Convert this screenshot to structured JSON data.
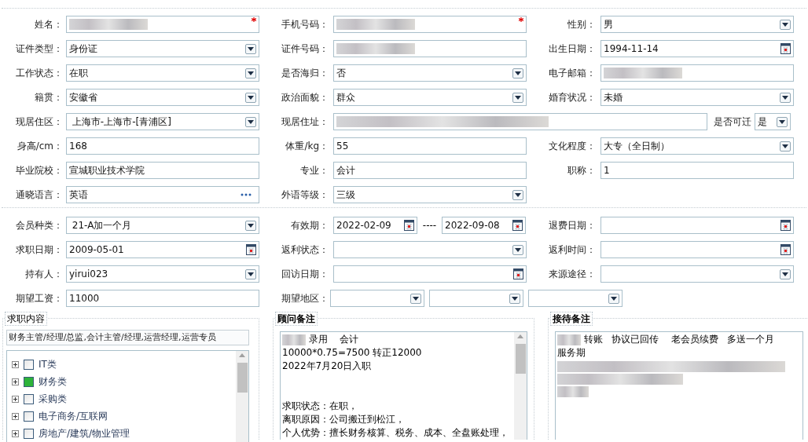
{
  "personal_rows": [
    [
      {
        "label": "姓名：",
        "kind": "redacted",
        "required": true
      },
      {
        "label": "手机号码：",
        "kind": "redacted",
        "required": true
      },
      {
        "label": "性别：",
        "kind": "select",
        "value": "男"
      }
    ],
    [
      {
        "label": "证件类型：",
        "kind": "select",
        "value": "身份证"
      },
      {
        "label": "证件号码：",
        "kind": "redacted"
      },
      {
        "label": "出生日期：",
        "kind": "date",
        "value": "1994-11-14"
      }
    ],
    [
      {
        "label": "工作状态：",
        "kind": "select",
        "value": "在职"
      },
      {
        "label": "是否海归：",
        "kind": "select",
        "value": "否"
      },
      {
        "label": "电子邮箱：",
        "kind": "redacted"
      }
    ],
    [
      {
        "label": "籍贯：",
        "kind": "select",
        "value": "安徽省"
      },
      {
        "label": "政治面貌：",
        "kind": "select",
        "value": "群众"
      },
      {
        "label": "婚育状况：",
        "kind": "select",
        "value": "未婚"
      }
    ],
    [
      {
        "label": "现居住区：",
        "kind": "select",
        "value": " 上海市-上海市-[青浦区]"
      },
      {
        "label": "现居住址：",
        "kind": "redacted",
        "wide": true
      },
      {
        "label": "是否可迁",
        "kind": "select",
        "value": "是",
        "compact": true
      }
    ],
    [
      {
        "label": "身高/cm：",
        "kind": "text",
        "value": "168"
      },
      {
        "label": "体重/kg：",
        "kind": "text",
        "value": "55"
      },
      {
        "label": "文化程度：",
        "kind": "select",
        "value": "大专（全日制）"
      }
    ],
    [
      {
        "label": "毕业院校：",
        "kind": "text",
        "value": "宣城职业技术学院"
      },
      {
        "label": "专业：",
        "kind": "text",
        "value": "会计"
      },
      {
        "label": "职称：",
        "kind": "text",
        "value": "1"
      }
    ],
    [
      {
        "label": "通晓语言：",
        "kind": "lookup",
        "value": "英语"
      },
      {
        "label": "外语等级：",
        "kind": "select",
        "value": "三级"
      }
    ]
  ],
  "membership_rows": [
    [
      {
        "label": "会员种类：",
        "kind": "select",
        "value": " 21-A加一个月"
      },
      {
        "label": "有效期：",
        "kind": "date_range",
        "values": [
          "2022-02-09",
          "2022-09-08"
        ],
        "separator": "----"
      },
      {
        "label": "退费日期：",
        "kind": "date"
      }
    ],
    [
      {
        "label": "求职日期：",
        "kind": "date",
        "value": "2009-05-01"
      },
      {
        "label": "返利状态：",
        "kind": "select"
      },
      {
        "label": "返利时间：",
        "kind": "date"
      }
    ],
    [
      {
        "label": "持有人：",
        "kind": "select",
        "value": "yirui023"
      },
      {
        "label": "回访日期：",
        "kind": "date"
      },
      {
        "label": "来源途径：",
        "kind": "select"
      }
    ],
    [
      {
        "label": "期望工资：",
        "kind": "text",
        "value": "11000"
      },
      {
        "label": "期望地区：",
        "kind": "triple_select"
      }
    ]
  ],
  "job_content": {
    "legend": "求职内容",
    "bold": false,
    "summary": "财务主管/经理/总监,会计主管/经理,运营经理,运营专员",
    "categories": [
      {
        "label": "IT类",
        "checked": false
      },
      {
        "label": "财务类",
        "checked": true
      },
      {
        "label": "采购类",
        "checked": false
      },
      {
        "label": "电子商务/互联网",
        "checked": false
      },
      {
        "label": "房地产/建筑/物业管理",
        "checked": false
      }
    ]
  },
  "consultant_notes": {
    "legend": "顾问备注",
    "bold": true,
    "paragraphs": [
      {
        "lines": [
          {
            "text": "录用    会计",
            "redacted_prefix": true
          },
          {
            "text": "10000*0.75=7500 转正12000"
          },
          {
            "text": "2022年7月20日入职"
          }
        ]
      },
      {
        "lines": [
          {
            "text": "求职状态：在职，"
          },
          {
            "text": "离职原因：公司搬迁到松江，"
          },
          {
            "text": "个人优势：擅长财务核算、税务、成本、全盘账处理，"
          }
        ]
      }
    ]
  },
  "reception_notes": {
    "legend": "接待备注",
    "bold": true,
    "paragraphs": [
      {
        "lines": [
          {
            "text": "转账   协议已回传    老会员续费   多送一个月",
            "redacted_prefix": true
          },
          {
            "text": "服务期"
          },
          {
            "redacted_block": true
          }
        ]
      }
    ]
  }
}
